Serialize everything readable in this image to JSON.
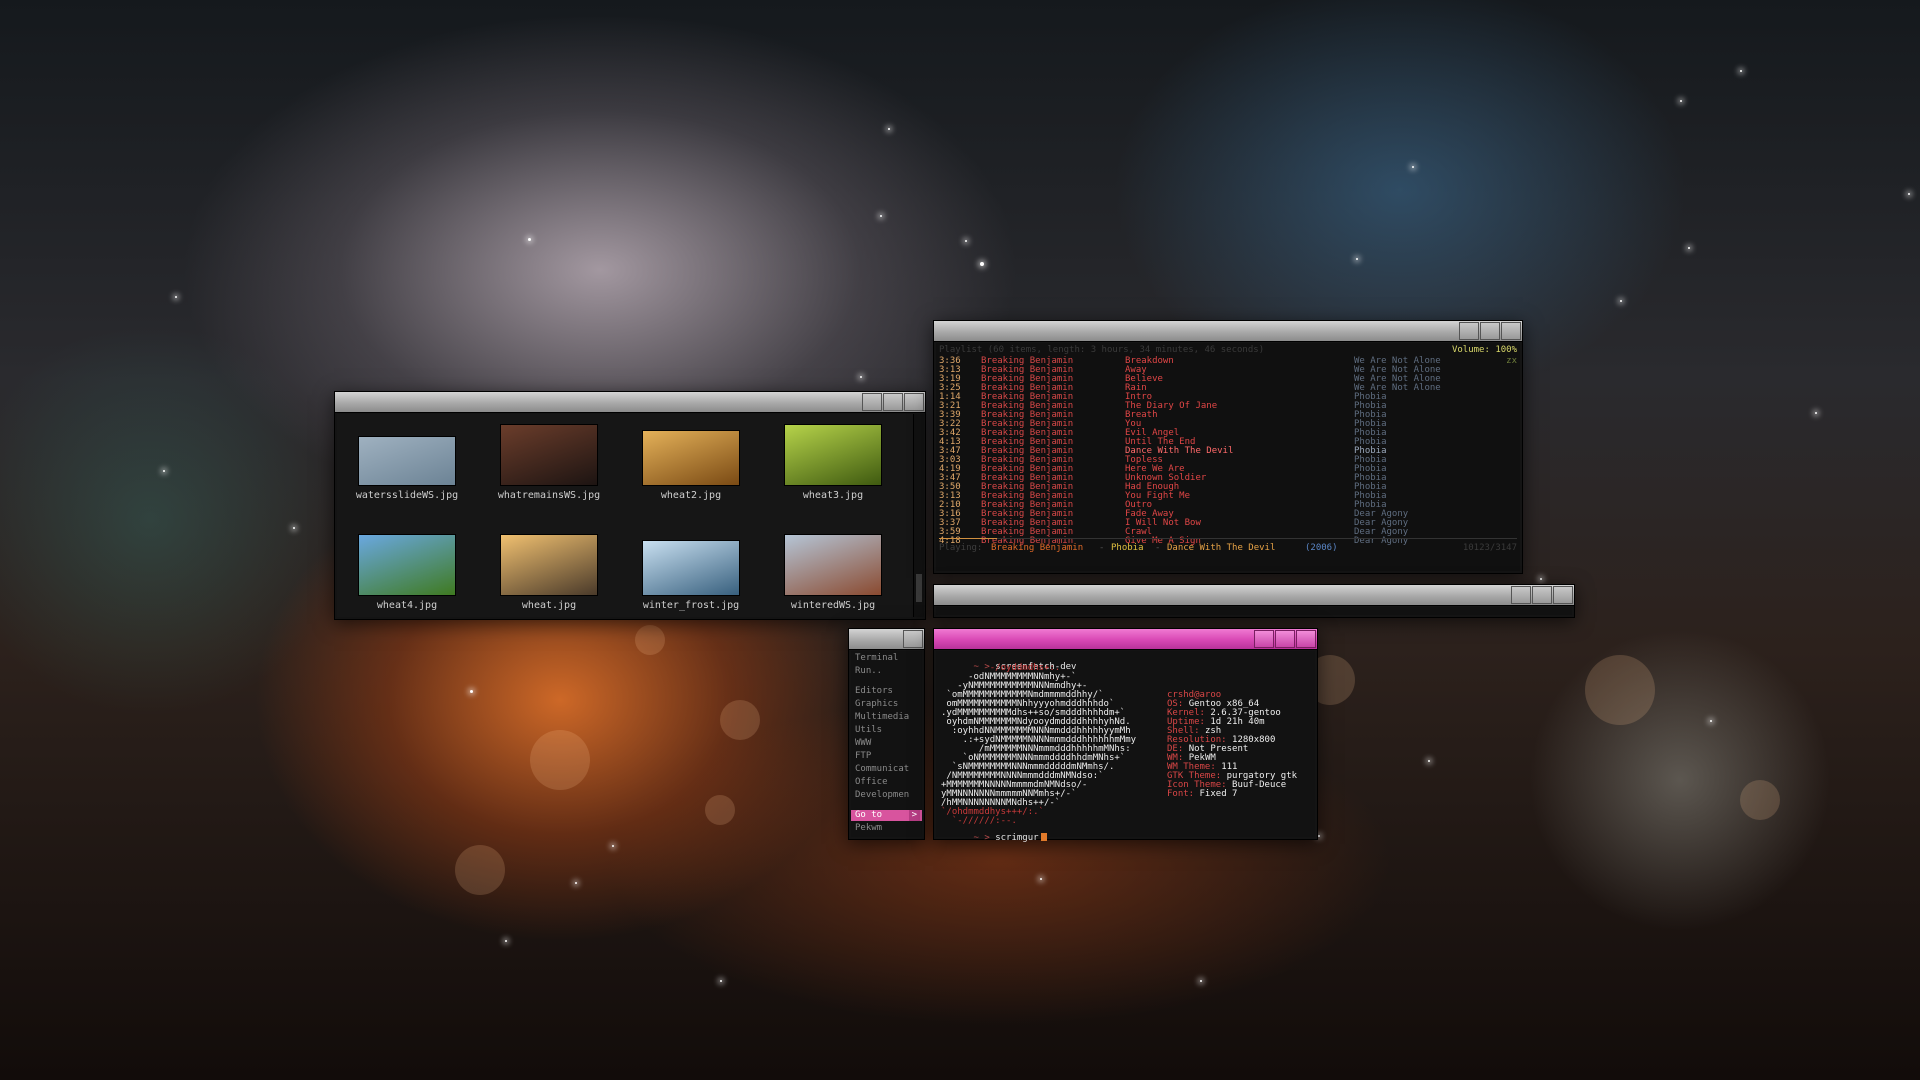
{
  "file_manager": {
    "files": [
      {
        "name": "watersslideWS.jpg",
        "colors": [
          "#9fb1c0",
          "#6c8395"
        ]
      },
      {
        "name": "whatremainsWS.jpg",
        "colors": [
          "#6b3d2b",
          "#1d1412"
        ]
      },
      {
        "name": "wheat2.jpg",
        "colors": [
          "#e4b159",
          "#7a4a14"
        ]
      },
      {
        "name": "wheat3.jpg",
        "colors": [
          "#b6d34a",
          "#3f5a10"
        ]
      },
      {
        "name": "wheat4.jpg",
        "colors": [
          "#6aa8e0",
          "#3f7a20"
        ]
      },
      {
        "name": "wheat.jpg",
        "colors": [
          "#f0c070",
          "#4a3a2a"
        ]
      },
      {
        "name": "winter_frost.jpg",
        "colors": [
          "#c8dff0",
          "#38607e"
        ]
      },
      {
        "name": "winteredWS.jpg",
        "colors": [
          "#b5c5d6",
          "#8a4a30"
        ]
      }
    ]
  },
  "playlist": {
    "header": "Playlist (60 items, length: 3 hours, 34 minutes, 46 seconds)",
    "volume": "Volume: 100%",
    "mode": "zx",
    "rows": [
      {
        "time": "3:36",
        "artist": "Breaking Benjamin",
        "title": "Breakdown",
        "album": "We Are Not Alone"
      },
      {
        "time": "3:13",
        "artist": "Breaking Benjamin",
        "title": "Away",
        "album": "We Are Not Alone"
      },
      {
        "time": "3:19",
        "artist": "Breaking Benjamin",
        "title": "Believe",
        "album": "We Are Not Alone"
      },
      {
        "time": "3:25",
        "artist": "Breaking Benjamin",
        "title": "Rain",
        "album": "We Are Not Alone"
      },
      {
        "time": "1:14",
        "artist": "Breaking Benjamin",
        "title": "Intro",
        "album": "Phobia"
      },
      {
        "time": "3:21",
        "artist": "Breaking Benjamin",
        "title": "The Diary Of Jane",
        "album": "Phobia"
      },
      {
        "time": "3:39",
        "artist": "Breaking Benjamin",
        "title": "Breath",
        "album": "Phobia"
      },
      {
        "time": "3:22",
        "artist": "Breaking Benjamin",
        "title": "You",
        "album": "Phobia"
      },
      {
        "time": "3:42",
        "artist": "Breaking Benjamin",
        "title": "Evil Angel",
        "album": "Phobia"
      },
      {
        "time": "4:13",
        "artist": "Breaking Benjamin",
        "title": "Until The End",
        "album": "Phobia"
      },
      {
        "time": "3:47",
        "artist": "Breaking Benjamin",
        "title": "Dance With The Devil",
        "album": "Phobia",
        "current": true
      },
      {
        "time": "3:03",
        "artist": "Breaking Benjamin",
        "title": "Topless",
        "album": "Phobia"
      },
      {
        "time": "4:19",
        "artist": "Breaking Benjamin",
        "title": "Here We Are",
        "album": "Phobia"
      },
      {
        "time": "3:47",
        "artist": "Breaking Benjamin",
        "title": "Unknown Soldier",
        "album": "Phobia"
      },
      {
        "time": "3:50",
        "artist": "Breaking Benjamin",
        "title": "Had Enough",
        "album": "Phobia"
      },
      {
        "time": "3:13",
        "artist": "Breaking Benjamin",
        "title": "You Fight Me",
        "album": "Phobia"
      },
      {
        "time": "2:10",
        "artist": "Breaking Benjamin",
        "title": "Outro",
        "album": "Phobia"
      },
      {
        "time": "3:16",
        "artist": "Breaking Benjamin",
        "title": "Fade Away",
        "album": "Dear Agony"
      },
      {
        "time": "3:37",
        "artist": "Breaking Benjamin",
        "title": "I Will Not Bow",
        "album": "Dear Agony"
      },
      {
        "time": "3:59",
        "artist": "Breaking Benjamin",
        "title": "Crawl",
        "album": "Dear Agony"
      },
      {
        "time": "4:18",
        "artist": "Breaking Benjamin",
        "title": "Give Me A Sign",
        "album": "Dear Agony"
      }
    ],
    "progress": 0.1,
    "now_playing": {
      "label": "Playing:",
      "artist": "Breaking Benjamin",
      "sep1": "-",
      "album": "Phobia",
      "sep2": "-",
      "title": "Dance With The Devil",
      "year": "(2006)",
      "position": "10123/3147"
    }
  },
  "menu": {
    "items": [
      {
        "label": "Terminal"
      },
      {
        "label": "Run.."
      },
      {
        "label": "Editors"
      },
      {
        "label": "Graphics"
      },
      {
        "label": "Multimedia"
      },
      {
        "label": "Utils"
      },
      {
        "label": "WWW"
      },
      {
        "label": "FTP"
      },
      {
        "label": "Communicat"
      },
      {
        "label": "Office"
      },
      {
        "label": "Developmen"
      },
      {
        "label": "Go to",
        "arrow": ">"
      },
      {
        "label": "Pekwm"
      }
    ]
  },
  "terminal": {
    "prompt": "~ >",
    "command1": "screenfetch-dev",
    "command2": "scrimgur",
    "art": [
      "         -/oyddmdhs+:.",
      "     -odNMMMMMMMMNNmhy+-`",
      "   -yNMMMMMMMMMMMNNNmmdhy+-",
      " `omMMMMMMMMMMMMNmdmmmmddhhy/`",
      " omMMMMMMMMMMMNhhyyyohmdddhhhdo`",
      ".ydMMMMMMMMMMdhs++so/smdddhhhhdm+`",
      " oyhdmNMMMMMMMNdyooydmddddhhhhyhNd.",
      "  :oyhhdNNMMMMMMMNNNmmdddhhhhhyymMh",
      "    .:+sydNMMMMMNNNNmmmdddhhhhhhmMmy",
      "       /mMMMMMMNNNmmmdddhhhhhmMNhs:",
      "    `oNMMMMMMMNNNmmmddddhhdmMNhs+`",
      "  `sNMMMMMMMMNNNmmmdddddmNMmhs/.",
      " /NMMMMMMMMNNNNmmmdddmNMNdso:`",
      "+MMMMMMMNNNNNmmmmdmNMNdso/-",
      "yMMNNNNNNNmmmmmNNMmhs+/-`",
      "/hMMNNNNNNNNMNdhs++/-`",
      "`/ohdmmddhys+++/:.`",
      "  `-//////:--."
    ],
    "info": [
      {
        "key": "",
        "value": "crshd@aroo"
      },
      {
        "key": "OS:",
        "value": "Gentoo x86_64"
      },
      {
        "key": "Kernel:",
        "value": "2.6.37-gentoo"
      },
      {
        "key": "Uptime:",
        "value": "1d 21h 40m"
      },
      {
        "key": "Shell:",
        "value": "zsh"
      },
      {
        "key": "Resolution:",
        "value": "1280x800"
      },
      {
        "key": "DE:",
        "value": "Not Present"
      },
      {
        "key": "WM:",
        "value": "PekWM"
      },
      {
        "key": "WM Theme:",
        "value": "111"
      },
      {
        "key": "GTK Theme:",
        "value": "purgatory gtk"
      },
      {
        "key": "Icon Theme:",
        "value": "Buuf-Deuce"
      },
      {
        "key": "Font:",
        "value": "Fixed 7"
      }
    ]
  }
}
